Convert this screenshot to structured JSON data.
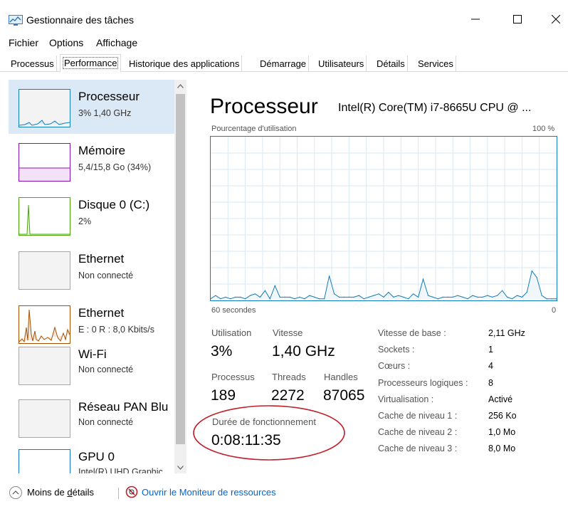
{
  "window": {
    "title": "Gestionnaire des tâches"
  },
  "menu": {
    "items": [
      "Fichier",
      "Options",
      "Affichage"
    ]
  },
  "tabs": [
    "Processus",
    "Performance",
    "Historique des applications",
    "Démarrage",
    "Utilisateurs",
    "Détails",
    "Services"
  ],
  "active_tab": "Performance",
  "sidebar": {
    "items": [
      {
        "title": "Processeur",
        "subtitle": "3% 1,40 GHz",
        "color": "#117dbb",
        "selected": true
      },
      {
        "title": "Mémoire",
        "subtitle": "5,4/15,8 Go (34%)",
        "color": "#8b12ae"
      },
      {
        "title": "Disque 0 (C:)",
        "subtitle": "2%",
        "color": "#4da60c"
      },
      {
        "title": "Ethernet",
        "subtitle": "Non connecté",
        "color": "#a7a7a7"
      },
      {
        "title": "Ethernet",
        "subtitle": "E : 0 R : 8,0 Kbits/s",
        "color": "#a74f01"
      },
      {
        "title": "Wi-Fi",
        "subtitle": "Non connecté",
        "color": "#a7a7a7"
      },
      {
        "title": "Réseau PAN Blu",
        "subtitle": "Non connecté",
        "color": "#a7a7a7"
      },
      {
        "title": "GPU 0",
        "subtitle": "Intel(R) UHD Graphic",
        "color": "#117dbb"
      }
    ]
  },
  "main": {
    "title": "Processeur",
    "model": "Intel(R) Core(TM) i7-8665U CPU @ ...",
    "graph": {
      "top_left_label": "Pourcentage d'utilisation",
      "top_right_label": "100 %",
      "bottom_left_label": "60 secondes",
      "bottom_right_label": "0",
      "line_color": "#117dbb",
      "fill_color": "#f1f6fa",
      "grid_color": "#d9eaf4"
    },
    "stats": {
      "utilisation_label": "Utilisation",
      "utilisation": "3%",
      "vitesse_label": "Vitesse",
      "vitesse": "1,40 GHz",
      "processus_label": "Processus",
      "processus": "189",
      "threads_label": "Threads",
      "threads": "2272",
      "handles_label": "Handles",
      "handles": "87065",
      "uptime_label": "Durée de fonctionnement",
      "uptime": "0:08:11:35"
    },
    "specs": [
      {
        "label": "Vitesse de base :",
        "value": "2,11 GHz"
      },
      {
        "label": "Sockets :",
        "value": "1"
      },
      {
        "label": "Cœurs :",
        "value": "4"
      },
      {
        "label": "Processeurs logiques :",
        "value": "8"
      },
      {
        "label": "Virtualisation :",
        "value": "Activé"
      },
      {
        "label": "Cache de niveau 1 :",
        "value": "256 Ko"
      },
      {
        "label": "Cache de niveau 2 :",
        "value": "1,0 Mo"
      },
      {
        "label": "Cache de niveau 3 :",
        "value": "8,0 Mo"
      }
    ]
  },
  "annotation": {
    "color": "#c0202a"
  },
  "footer": {
    "less_details": "Moins de ",
    "less_details_underlined": "d",
    "less_details_rest": "étails",
    "resource_monitor": "Ouvrir le Moniteur de ressources"
  },
  "chart_data": {
    "type": "line",
    "ylim": [
      0,
      100
    ],
    "x_window_seconds": 60,
    "series": [
      {
        "values": [
          1,
          3,
          1,
          2,
          1,
          2,
          2,
          1,
          3,
          4,
          2,
          6,
          1,
          9,
          2,
          2,
          2,
          1,
          2,
          1,
          3,
          2,
          1,
          1,
          15,
          4,
          2,
          2,
          2,
          2,
          3,
          1,
          2,
          3,
          4,
          2,
          5,
          2,
          3,
          2,
          1,
          4,
          2,
          13,
          3,
          2,
          1,
          2,
          2,
          2,
          3,
          2,
          1,
          3,
          2,
          2,
          3,
          2,
          3,
          6,
          2,
          1,
          3,
          2,
          5,
          18,
          14,
          3,
          1,
          1,
          1
        ]
      }
    ]
  }
}
